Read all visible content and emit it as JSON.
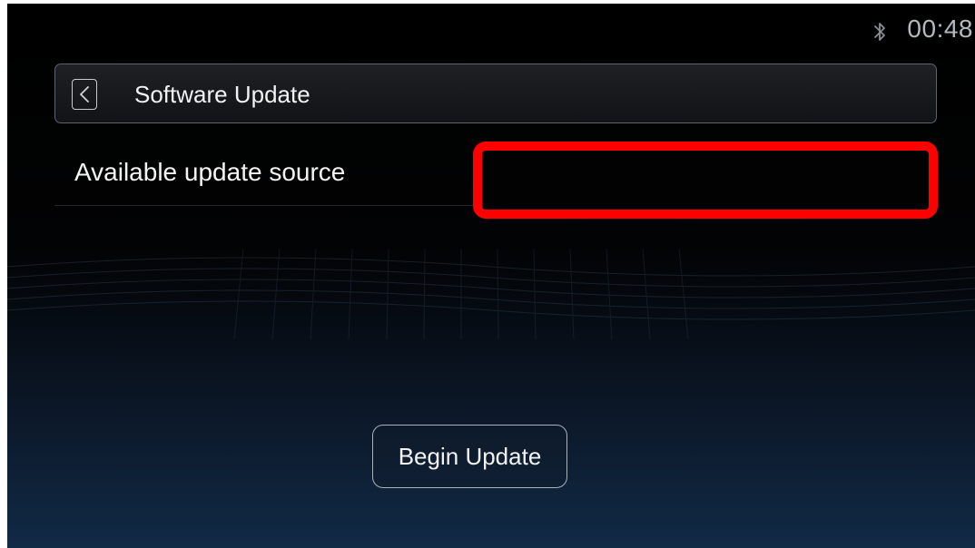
{
  "status_bar": {
    "bluetooth_icon": "bluetooth-icon",
    "time": "00:48"
  },
  "header": {
    "back_icon": "chevron-left-icon",
    "title": "Software Update"
  },
  "update_source": {
    "label": "Available update source",
    "value": ""
  },
  "actions": {
    "begin_update_label": "Begin Update"
  },
  "colors": {
    "highlight": "#ff0000",
    "background_top": "#000000",
    "background_bottom": "#112a46",
    "text": "#f2f2f2"
  }
}
